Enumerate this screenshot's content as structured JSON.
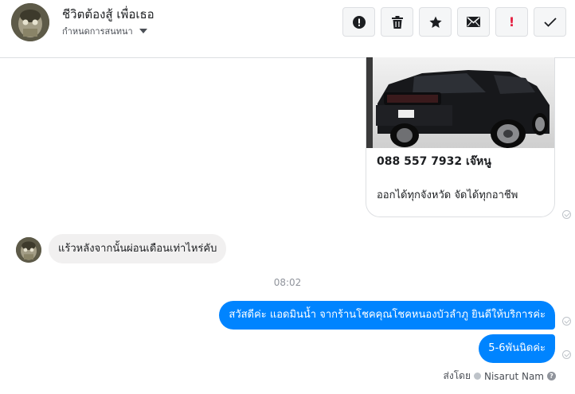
{
  "header": {
    "name": "ชีวิตต้องสู้ เพื่อเธอ",
    "subtitle": "กำหนดการสนทนา"
  },
  "toolbar": {
    "buttons": [
      {
        "icon": "alert-circle-icon"
      },
      {
        "icon": "trash-icon"
      },
      {
        "icon": "star-icon"
      },
      {
        "icon": "envelope-icon"
      },
      {
        "icon": "exclamation-icon",
        "glyph": "!"
      },
      {
        "icon": "checkmark-icon"
      }
    ]
  },
  "card": {
    "image": "black-pickup-truck-photo",
    "phone": "088 557 7932 เจ๊หนู",
    "description": "ออกได้ทุกจังหวัด จัดได้ทุกอาชีพ"
  },
  "messages": {
    "incoming": "แร้วหลังจากนั้นผ่อนเดือนเท่าไหร่คับ",
    "timestamp": "08:02",
    "outgoing_1": "สวัสดีค่ะ แอดมินน้ำ จากร้านโชคคุณโชคหนองบัวลำภู ยินดีให้บริการค่ะ",
    "outgoing_2": "5-6พันนิดค่ะ"
  },
  "sent_by": {
    "prefix": "ส่งโดย",
    "name": "Nisarut Nam",
    "help": "?"
  },
  "colors": {
    "outgoing_bubble": "#0084ff",
    "incoming_bubble": "#f1f0f0",
    "danger": "#e41e3f"
  }
}
